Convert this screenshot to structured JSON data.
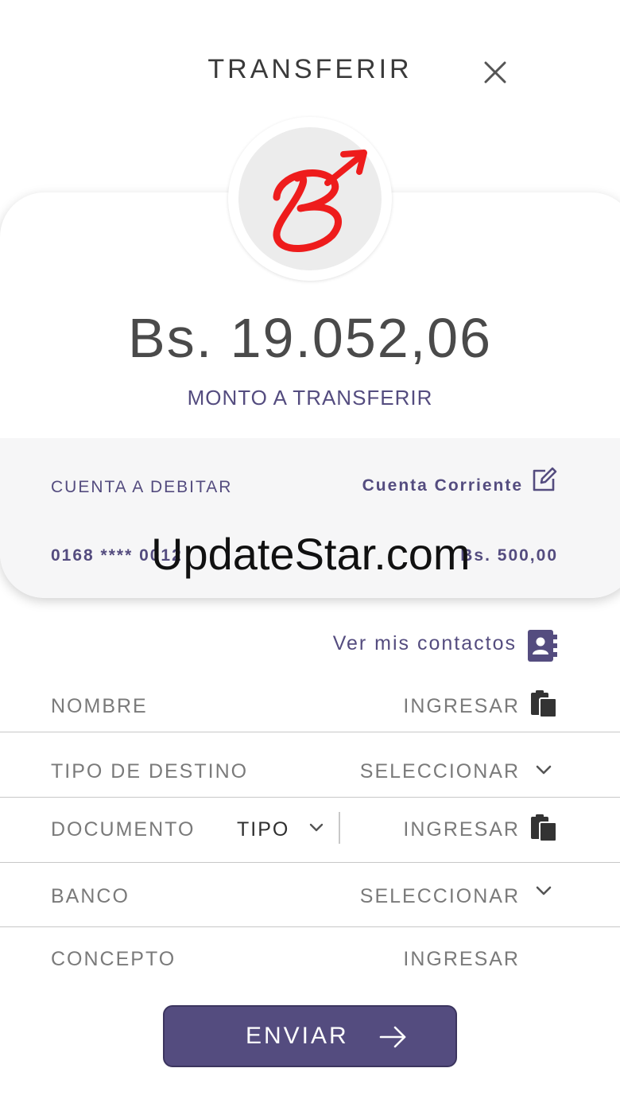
{
  "header": {
    "title": "TRANSFERIR"
  },
  "amount": {
    "value": "Bs. 19.052,06",
    "label": "MONTO A TRANSFERIR"
  },
  "debit_account": {
    "label": "CUENTA A DEBITAR",
    "type": "Cuenta Corriente",
    "number": "0168 **** 0012",
    "balance": "Bs. 500,00"
  },
  "watermark": "UpdateStar.com",
  "contacts": {
    "label": "Ver mis contactos"
  },
  "form": {
    "nombre": {
      "label": "NOMBRE",
      "action": "INGRESAR"
    },
    "tipo_destino": {
      "label": "TIPO DE DESTINO",
      "action": "SELECCIONAR"
    },
    "documento": {
      "label": "DOCUMENTO",
      "tipo": "TIPO",
      "action": "INGRESAR"
    },
    "banco": {
      "label": "BANCO",
      "action": "SELECCIONAR"
    },
    "concepto": {
      "label": "CONCEPTO",
      "action": "INGRESAR"
    }
  },
  "send_button": {
    "label": "ENVIAR"
  },
  "colors": {
    "accent": "#544c7f",
    "logo_red": "#ee1c1c",
    "text_gray": "#7a7a7a"
  },
  "icons": [
    "close-icon",
    "bank-logo-icon",
    "edit-icon",
    "contacts-book-icon",
    "clipboard-icon",
    "chevron-down-icon",
    "arrow-right-icon"
  ]
}
